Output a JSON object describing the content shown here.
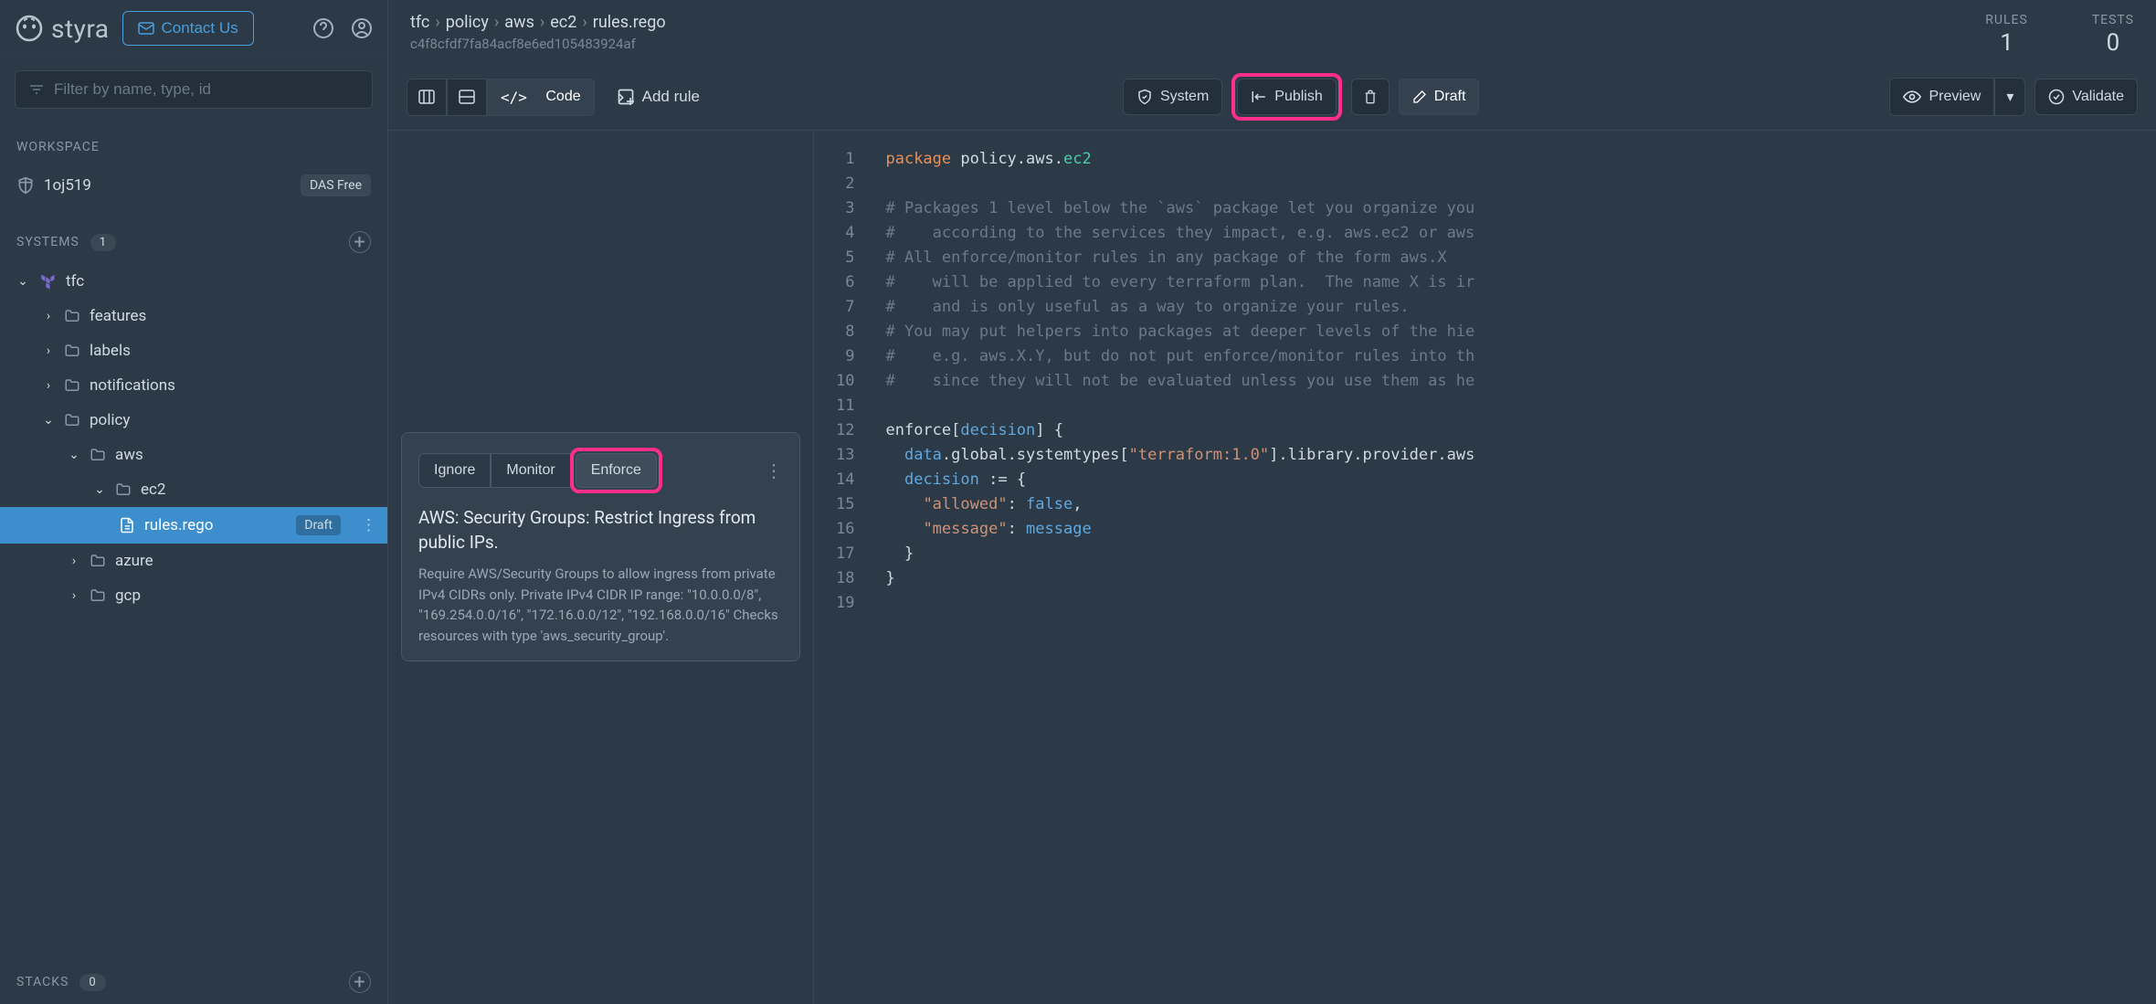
{
  "header": {
    "brand": "styra",
    "contact": "Contact Us"
  },
  "search": {
    "placeholder": "Filter by name, type, id"
  },
  "sidebar": {
    "workspace_label": "WORKSPACE",
    "workspace_name": "1oj519",
    "workspace_badge": "DAS Free",
    "systems_label": "SYSTEMS",
    "systems_count": "1",
    "stacks_label": "STACKS",
    "stacks_count": "0",
    "tree": {
      "system": "tfc",
      "features": "features",
      "labels": "labels",
      "notifications": "notifications",
      "policy": "policy",
      "aws": "aws",
      "ec2": "ec2",
      "rules": "rules.rego",
      "draft": "Draft",
      "azure": "azure",
      "gcp": "gcp"
    }
  },
  "breadcrumb": {
    "p1": "tfc",
    "p2": "policy",
    "p3": "aws",
    "p4": "ec2",
    "p5": "rules.rego"
  },
  "hash": "c4f8cfdf7fa84acf8e6ed105483924af",
  "stats": {
    "rules_label": "RULES",
    "rules_val": "1",
    "tests_label": "TESTS",
    "tests_val": "0"
  },
  "toolbar": {
    "code": "Code",
    "addrule": "Add rule",
    "system": "System",
    "publish": "Publish",
    "draft": "Draft",
    "preview": "Preview",
    "validate": "Validate"
  },
  "card": {
    "ignore": "Ignore",
    "monitor": "Monitor",
    "enforce": "Enforce",
    "title": "AWS: Security Groups: Restrict Ingress from public IPs.",
    "desc": "Require AWS/Security Groups to allow ingress from private IPv4 CIDRs only. Private IPv4 CIDR IP range: \"10.0.0.0/8\", \"169.254.0.0/16\", \"172.16.0.0/12\", \"192.168.0.0/16\" Checks resources with type 'aws_security_group'."
  },
  "code": {
    "lines": [
      "1",
      "2",
      "3",
      "4",
      "5",
      "6",
      "7",
      "8",
      "9",
      "10",
      "11",
      "12",
      "13",
      "14",
      "15",
      "16",
      "17",
      "18",
      "19"
    ],
    "l1_package": "package",
    "l1_path1": " policy.aws.",
    "l1_path2": "ec2",
    "c3": "# Packages 1 level below the `aws` package let you organize you",
    "c4": "#    according to the services they impact, e.g. aws.ec2 or aws",
    "c5": "# All enforce/monitor rules in any package of the form aws.X",
    "c6": "#    will be applied to every terraform plan.  The name X is ir",
    "c7": "#    and is only useful as a way to organize your rules.",
    "c8": "# You may put helpers into packages at deeper levels of the hie",
    "c9": "#    e.g. aws.X.Y, but do not put enforce/monitor rules into th",
    "c10": "#    since they will not be evaluated unless you use them as he",
    "l12_enforce": "enforce",
    "l12_decision": "decision",
    "l13_data": "data",
    "l13_rest": ".global.systemtypes[",
    "l13_str": "\"terraform:1.0\"",
    "l13_rest2": "].library.provider.aws",
    "l14_decision": "decision",
    "l14_assign": " := ",
    "l15_key": "\"allowed\"",
    "l15_false": "false",
    "l16_key": "\"message\"",
    "l16_msg": "message"
  }
}
